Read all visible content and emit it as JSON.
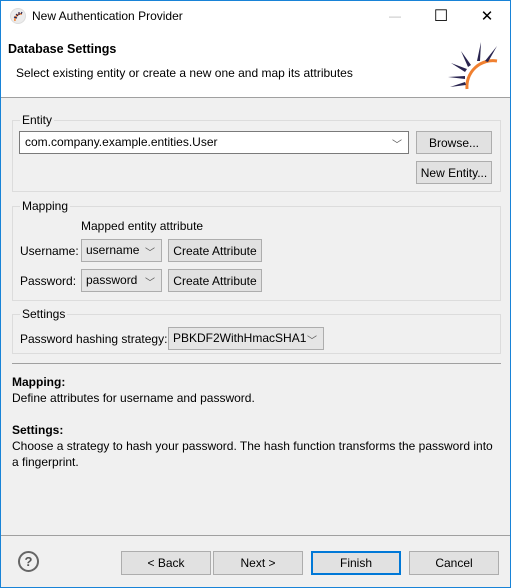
{
  "window": {
    "title": "New Authentication Provider",
    "controls": {
      "minimize": "—",
      "maximize": "☐",
      "close": "✕"
    },
    "accent_color": "#0078d7"
  },
  "header": {
    "title": "Database Settings",
    "description": "Select existing entity or create a new one and map its attributes"
  },
  "entity": {
    "group_label": "Entity",
    "value": "com.company.example.entities.User",
    "browse_label": "Browse...",
    "new_entity_label": "New Entity..."
  },
  "mapping": {
    "group_label": "Mapping",
    "column_header": "Mapped entity attribute",
    "rows": [
      {
        "label": "Username:",
        "value": "username",
        "button": "Create Attribute"
      },
      {
        "label": "Password:",
        "value": "password",
        "button": "Create Attribute"
      }
    ]
  },
  "settings": {
    "group_label": "Settings",
    "hashing_label": "Password hashing strategy:",
    "hashing_value": "PBKDF2WithHmacSHA1"
  },
  "help": {
    "mapping_title": "Mapping:",
    "mapping_text": "Define attributes for username and password.",
    "settings_title": "Settings:",
    "settings_text": "Choose a strategy to hash your password. The hash function transforms the password into a fingerprint."
  },
  "footer": {
    "help_icon": "?",
    "back_label": "< Back",
    "next_label": "Next >",
    "finish_label": "Finish",
    "cancel_label": "Cancel"
  },
  "icons": {
    "chevron": "﹀"
  }
}
